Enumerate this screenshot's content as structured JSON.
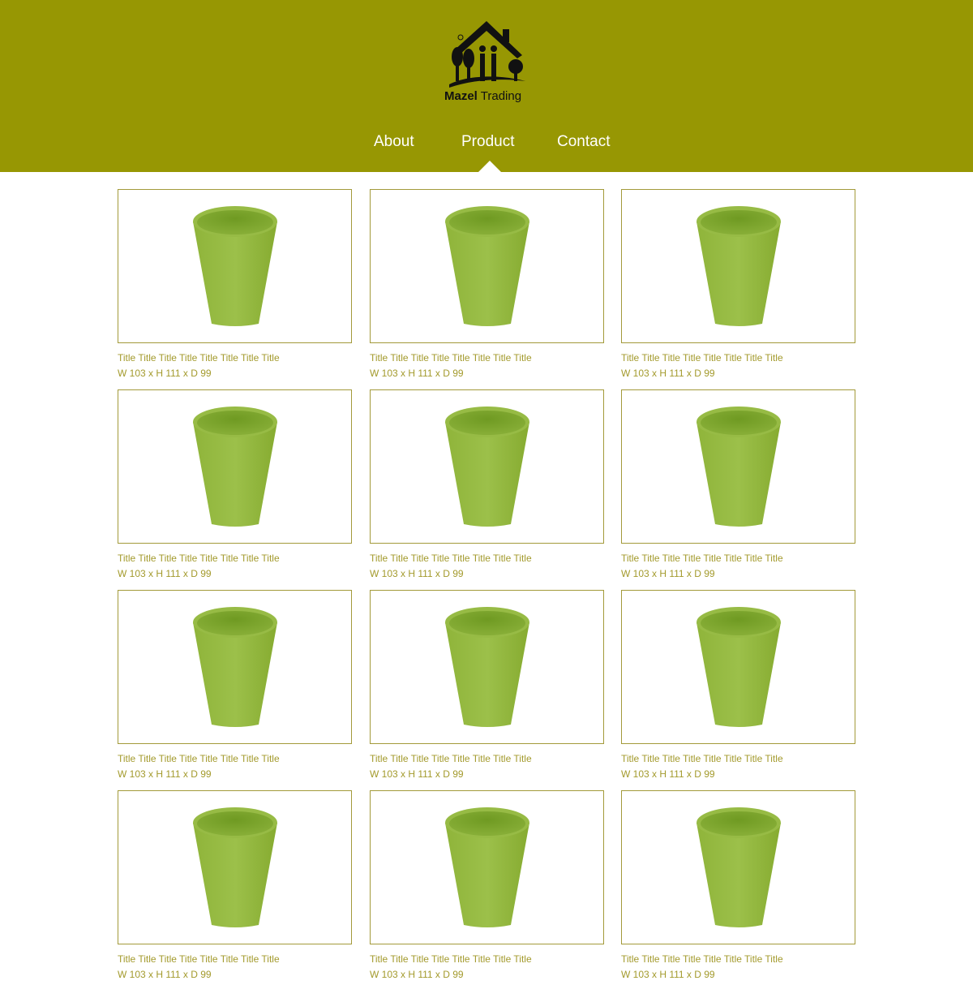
{
  "brand": {
    "name_bold": "Mazel",
    "name_regular": "Trading",
    "logo_icon": "house-logo-icon",
    "header_color": "#979703"
  },
  "nav": {
    "items": [
      {
        "label": "About"
      },
      {
        "label": "Product"
      },
      {
        "label": "Contact"
      }
    ],
    "active": "Product"
  },
  "products": [
    {
      "title": "Title Title Title Title Title Title Title Title",
      "dims": "W 103 x H 111 x D 99",
      "image": "green-cup-image"
    },
    {
      "title": "Title Title Title Title Title Title Title Title",
      "dims": "W 103 x H 111 x D 99",
      "image": "green-cup-image"
    },
    {
      "title": "Title Title Title Title Title Title Title Title",
      "dims": "W 103 x H 111 x D 99",
      "image": "green-cup-image"
    },
    {
      "title": "Title Title Title Title Title Title Title Title",
      "dims": "W 103 x H 111 x D 99",
      "image": "green-cup-image"
    },
    {
      "title": "Title Title Title Title Title Title Title Title",
      "dims": "W 103 x H 111 x D 99",
      "image": "green-cup-image"
    },
    {
      "title": "Title Title Title Title Title Title Title Title",
      "dims": "W 103 x H 111 x D 99",
      "image": "green-cup-image"
    },
    {
      "title": "Title Title Title Title Title Title Title Title",
      "dims": "W 103 x H 111 x D 99",
      "image": "green-cup-image"
    },
    {
      "title": "Title Title Title Title Title Title Title Title",
      "dims": "W 103 x H 111 x D 99",
      "image": "green-cup-image"
    },
    {
      "title": "Title Title Title Title Title Title Title Title",
      "dims": "W 103 x H 111 x D 99",
      "image": "green-cup-image"
    },
    {
      "title": "Title Title Title Title Title Title Title Title",
      "dims": "W 103 x H 111 x D 99",
      "image": "green-cup-image"
    },
    {
      "title": "Title Title Title Title Title Title Title Title",
      "dims": "W 103 x H 111 x D 99",
      "image": "green-cup-image"
    },
    {
      "title": "Title Title Title Title Title Title Title Title",
      "dims": "W 103 x H 111 x D 99",
      "image": "green-cup-image"
    }
  ]
}
